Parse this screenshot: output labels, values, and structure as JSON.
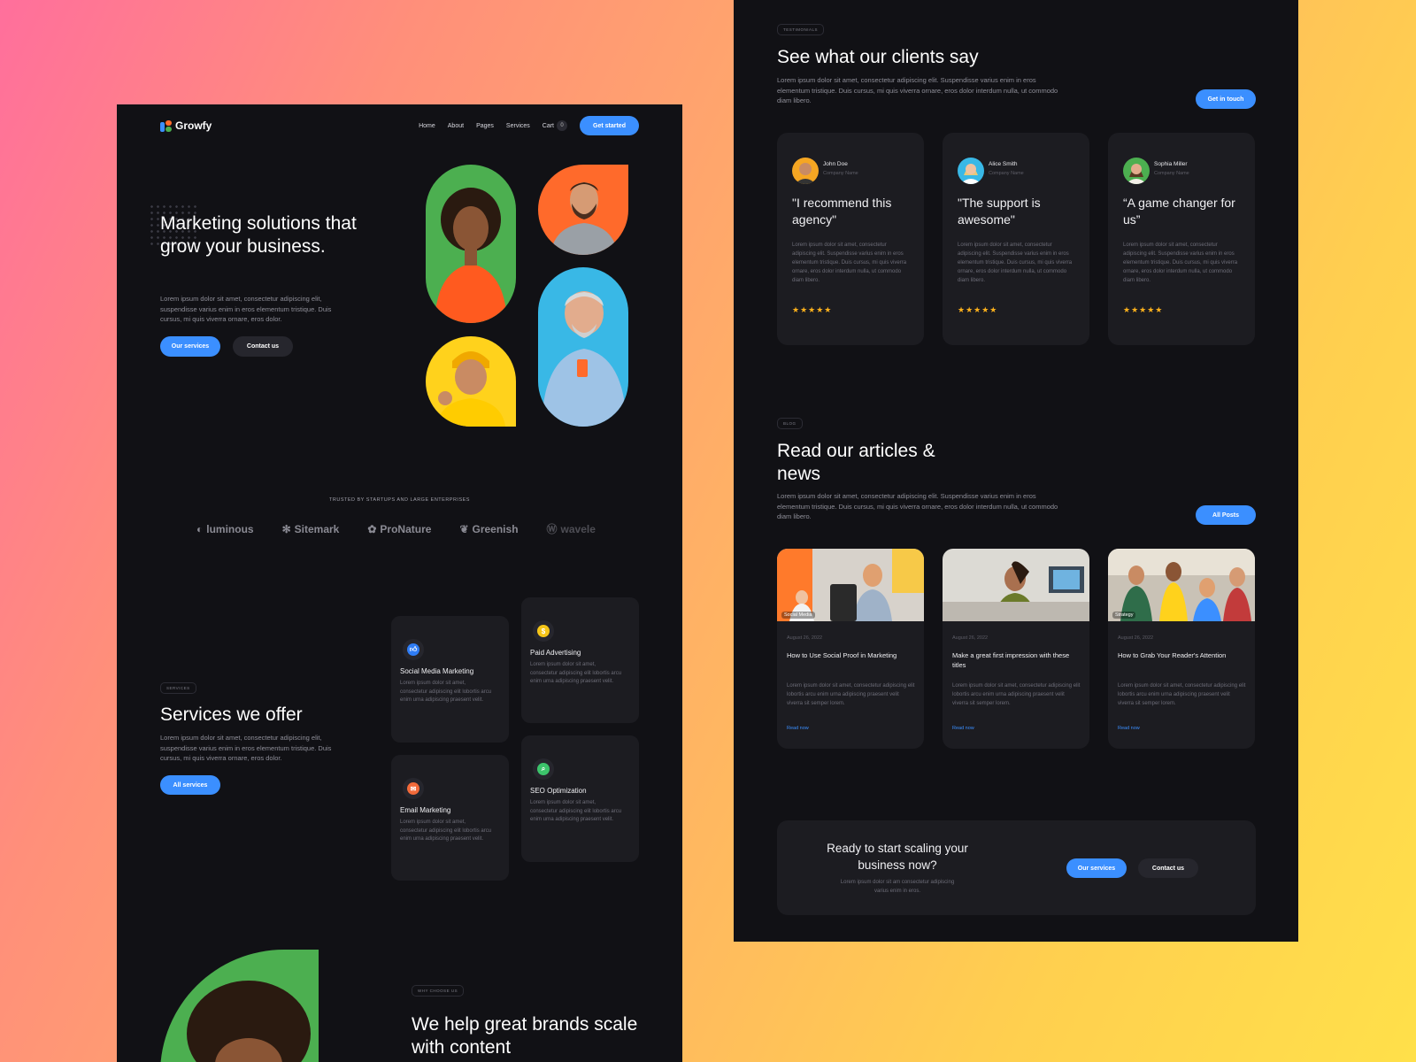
{
  "colors": {
    "accent": "#3b8fff",
    "panel_bg": "#111115",
    "card_bg": "#1c1c21",
    "star": "#ffb21c"
  },
  "left": {
    "nav": {
      "logo": "Growfy",
      "links": [
        "Home",
        "About",
        "Pages",
        "Services"
      ],
      "cart_label": "Cart",
      "cart_count": "0",
      "cta": "Get started"
    },
    "hero": {
      "title": "Marketing solutions that grow your business.",
      "text": "Lorem ipsum dolor sit amet, consectetur adipiscing elit, suspendisse varius enim in eros elementum tristique. Duis cursus, mi quis viverra ornare, eros dolor.",
      "primary_button": "Our services",
      "secondary_button": "Contact us"
    },
    "trusted": {
      "label": "TRUSTED BY STARTUPS AND LARGE ENTERPRISES",
      "logos": [
        "luminous",
        "Sitemark",
        "ProNature",
        "Greenish",
        "wavele"
      ]
    },
    "services": {
      "tag": "SERVICES",
      "title": "Services we offer",
      "text": "Lorem ipsum dolor sit amet, consectetur adipiscing elit, suspendisse varius enim in eros elementum tristique. Duis cursus, mi quis viverra ornare, eros dolor.",
      "button": "All services",
      "cards": [
        {
          "title": "Social Media Marketing",
          "text": "Lorem ipsum dolor sit amet, consectetur adipiscing elit lobortis arcu enim urna adipiscing praesent velit.",
          "icon": "thumbs-up-icon",
          "icon_color": "#2f7df6"
        },
        {
          "title": "Paid Advertising",
          "text": "Lorem ipsum dolor sit amet, consectetur adipiscing elit lobortis arcu enim urna adipiscing praesent velit.",
          "icon": "dollar-icon",
          "icon_color": "#f5c518"
        },
        {
          "title": "Email Marketing",
          "text": "Lorem ipsum dolor sit amet, consectetur adipiscing elit lobortis arcu enim urna adipiscing praesent velit.",
          "icon": "mail-icon",
          "icon_color": "#f26a3a"
        },
        {
          "title": "SEO Optimization",
          "text": "Lorem ipsum dolor sit amet, consectetur adipiscing elit lobortis arcu enim urna adipiscing praesent velit.",
          "icon": "search-icon",
          "icon_color": "#3cc36b"
        }
      ]
    },
    "why": {
      "tag": "WHY CHOOSE US",
      "title": "We help great brands scale with content"
    }
  },
  "right": {
    "testimonials": {
      "tag": "TESTIMONIALS",
      "title": "See what our clients say",
      "text": "Lorem ipsum dolor sit amet, consectetur adipiscing elit. Suspendisse varius enim in eros elementum tristique. Duis cursus, mi quis viverra ornare, eros dolor interdum nulla, ut commodo diam libero.",
      "button": "Get in touch",
      "items": [
        {
          "name": "John Doe",
          "company": "Company Name",
          "quote": "\"I recommend this agency\"",
          "body": "Lorem ipsum dolor sit amet, consectetur adipiscing elit. Suspendisse varius enim in eros elementum tristique. Duis cursus, mi quis viverra ornare, eros dolor interdum nulla, ut commodo diam libero.",
          "stars": "★★★★★",
          "avatar_color": "#f5a623"
        },
        {
          "name": "Alice Smith",
          "company": "Company Name",
          "quote": "\"The support is awesome\"",
          "body": "Lorem ipsum dolor sit amet, consectetur adipiscing elit. Suspendisse varius enim in eros elementum tristique. Duis cursus, mi quis viverra ornare, eros dolor interdum nulla, ut commodo diam libero.",
          "stars": "★★★★★",
          "avatar_color": "#39b8e6"
        },
        {
          "name": "Sophia Miller",
          "company": "Company Name",
          "quote": "“A game changer for us”",
          "body": "Lorem ipsum dolor sit amet, consectetur adipiscing elit. Suspendisse varius enim in eros elementum tristique. Duis cursus, mi quis viverra ornare, eros dolor interdum nulla, ut commodo diam libero.",
          "stars": "★★★★★",
          "avatar_color": "#4caf50"
        }
      ]
    },
    "blog": {
      "tag": "BLOG",
      "title": "Read our articles & news",
      "text": "Lorem ipsum dolor sit amet, consectetur adipiscing elit. Suspendisse varius enim in eros elementum tristique. Duis cursus, mi quis viverra ornare, eros dolor interdum nulla, ut commodo diam libero.",
      "button": "All Posts",
      "posts": [
        {
          "category": "Social Media",
          "date": "August 26, 2022",
          "title": "How to Use Social Proof in Marketing",
          "body": "Lorem ipsum dolor sit amet, consectetur adipiscing elit lobortis arcu enim urna adipiscing praesent velit viverra sit semper lorem.",
          "link": "Read now"
        },
        {
          "category": "",
          "date": "August 26, 2022",
          "title": "Make a great first impression with these titles",
          "body": "Lorem ipsum dolor sit amet, consectetur adipiscing elit lobortis arcu enim urna adipiscing praesent velit viverra sit semper lorem.",
          "link": "Read now"
        },
        {
          "category": "Strategy",
          "date": "August 26, 2022",
          "title": "How to Grab Your Reader's Attention",
          "body": "Lorem ipsum dolor sit amet, consectetur adipiscing elit lobortis arcu enim urna adipiscing praesent velit viverra sit semper lorem.",
          "link": "Read now"
        }
      ]
    },
    "cta": {
      "title": "Ready to start scaling your business now?",
      "text": "Lorem ipsum dolor sit am consectetur adipiscing varius enim in eros.",
      "primary_button": "Our services",
      "secondary_button": "Contact us"
    }
  }
}
